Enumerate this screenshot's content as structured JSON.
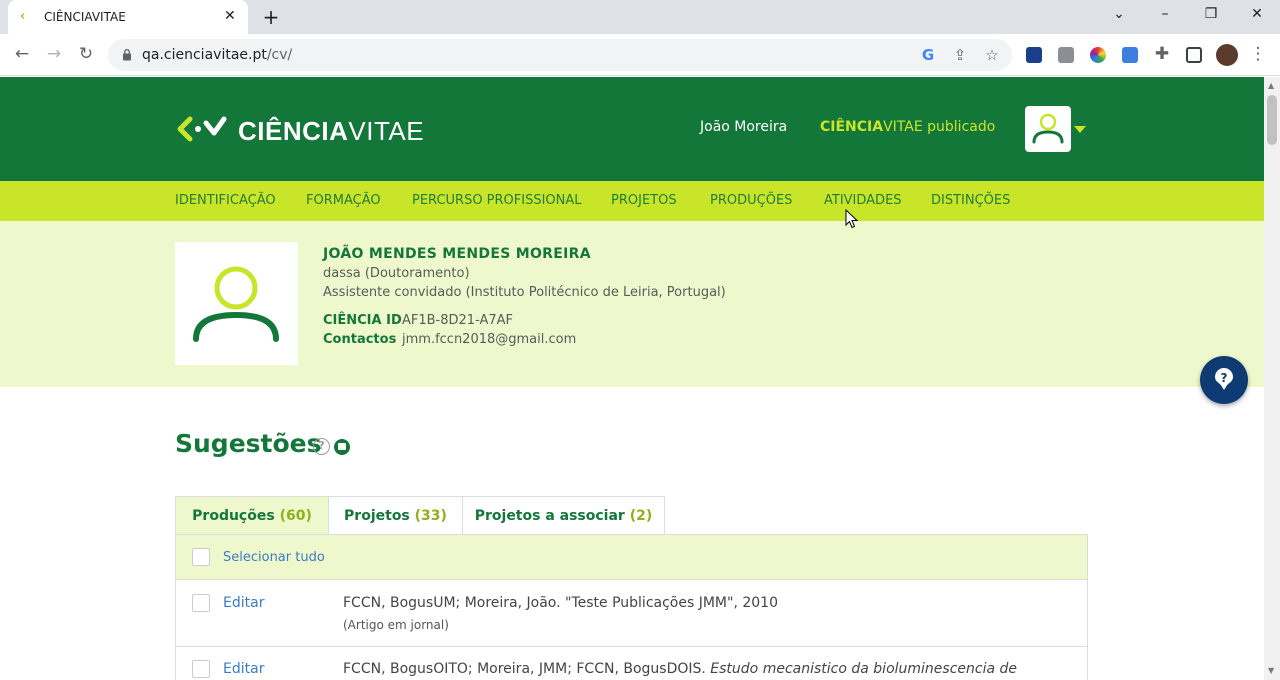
{
  "browser": {
    "tab_title": "CIÊNCIAVITAE",
    "url_host": "qa.cienciavitae.pt",
    "url_path": "/cv/",
    "icons": [
      "back-icon",
      "forward-icon",
      "reload-icon",
      "lock-icon",
      "google-icon",
      "share-icon",
      "star-icon",
      "puzzle-icon",
      "sidepanel-icon",
      "menu-icon"
    ]
  },
  "header": {
    "logo_bold": "CIÊNCIA",
    "logo_thin": "VITAE",
    "user_name": "João Moreira",
    "status_bold": "CIÊNCIA",
    "status_rest": "VITAE publicado"
  },
  "nav": {
    "items": [
      "IDENTIFICAÇÃO",
      "FORMAÇÃO",
      "PERCURSO PROFISSIONAL",
      "PROJETOS",
      "PRODUÇÕES",
      "ATIVIDADES",
      "DISTINÇÕES"
    ]
  },
  "profile": {
    "name": "JOÃO MENDES MENDES MOREIRA",
    "degree": "dassa (Doutoramento)",
    "position": "Assistente convidado (Instituto Politécnico de Leiria, Portugal)",
    "ciencia_id_label": "CIÊNCIA ID",
    "ciencia_id": "AF1B-8D21-A7AF",
    "contacts_label": "Contactos",
    "email": "jmm.fccn2018@gmail.com"
  },
  "suggestions": {
    "title": "Sugestões",
    "tabs": [
      {
        "label": "Produções",
        "count": "(60)"
      },
      {
        "label": "Projetos",
        "count": "(33)"
      },
      {
        "label": "Projetos a associar",
        "count": "(2)"
      }
    ],
    "select_all": "Selecionar tudo",
    "rows": [
      {
        "edit": "Editar",
        "citation": "FCCN, BogusUM; Moreira, João. \"Teste Publicações JMM\", 2010",
        "type": "(Artigo em jornal)"
      },
      {
        "edit": "Editar",
        "citation_plain": "FCCN, BogusOITO; Moreira, JMM; FCCN, BogusDOIS. ",
        "citation_italic": "Estudo mecanistico da bioluminescencia de"
      }
    ]
  },
  "colors": {
    "header_green": "#13773a",
    "lime": "#c8e52a",
    "light_lime": "#eff8cc",
    "link_blue": "#3a7cc4",
    "help_navy": "#0e3a73"
  }
}
